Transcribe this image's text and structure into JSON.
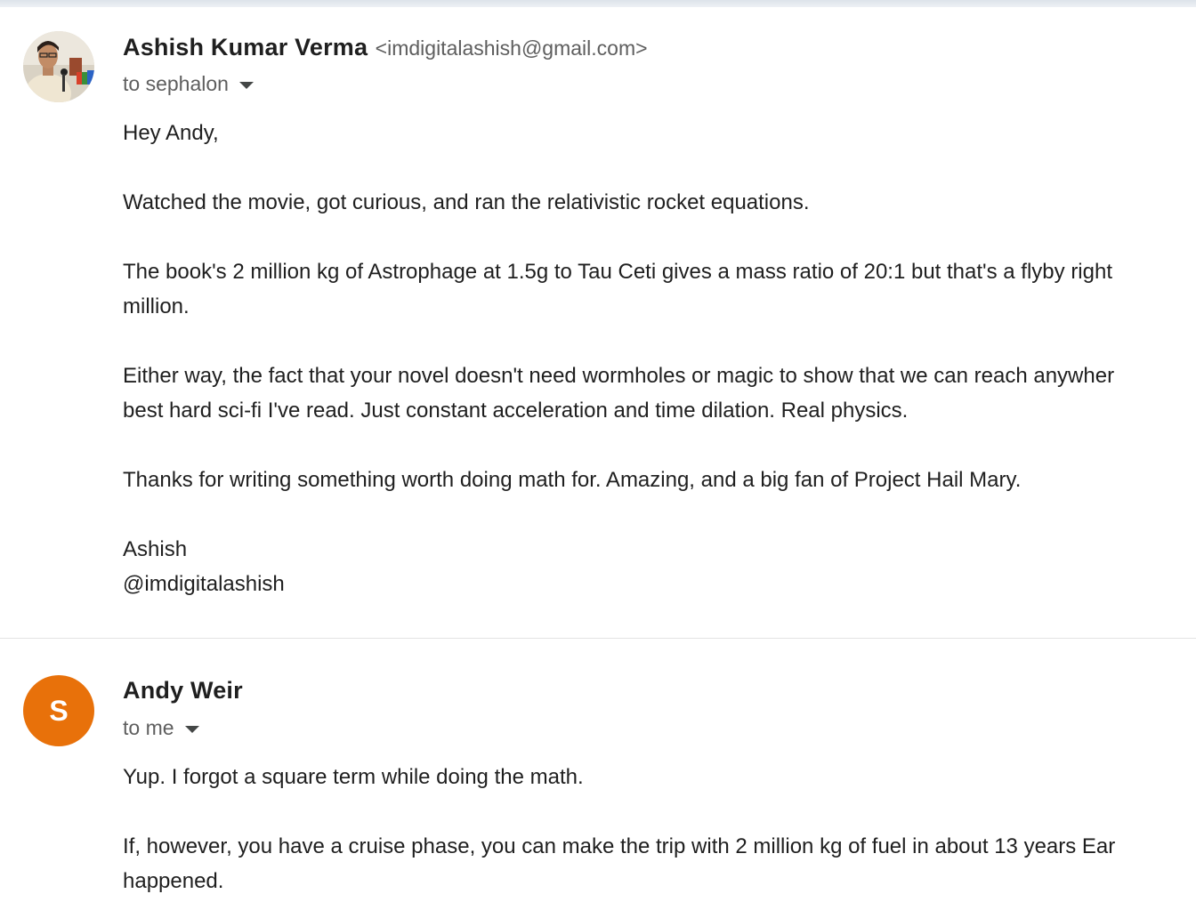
{
  "messages": [
    {
      "sender_name": "Ashish Kumar Verma",
      "sender_email": "<imdigitalashish@gmail.com>",
      "recipients": "to sephalon",
      "avatar": "profile-photo",
      "body": {
        "greeting": "Hey Andy,",
        "p1": "Watched the movie, got curious, and ran the relativistic rocket equations.",
        "p2_l1": "The book's 2 million kg of Astrophage at 1.5g to Tau Ceti gives a mass ratio of 20:1 but that's a flyby right",
        "p2_l2": "million.",
        "p3_l1": "Either way, the fact that your novel doesn't need wormholes or magic to show that we can reach anywher",
        "p3_l2": "best hard sci-fi I've read. Just constant acceleration and time dilation. Real physics.",
        "p4": "Thanks for writing something worth doing math for. Amazing, and a big fan of Project Hail Mary.",
        "sig_l1": "Ashish",
        "sig_l2": "@imdigitalashish"
      }
    },
    {
      "sender_name": "Andy Weir",
      "recipients": "to me",
      "avatar_letter": "S",
      "avatar_color": "#e8710a",
      "body": {
        "p1": "Yup. I forgot a square term while doing the math.",
        "p2_l1": "If, however, you have a cruise phase, you can make the trip with 2 million kg of fuel in about 13 years Ear",
        "p2_l2": "happened."
      }
    }
  ]
}
